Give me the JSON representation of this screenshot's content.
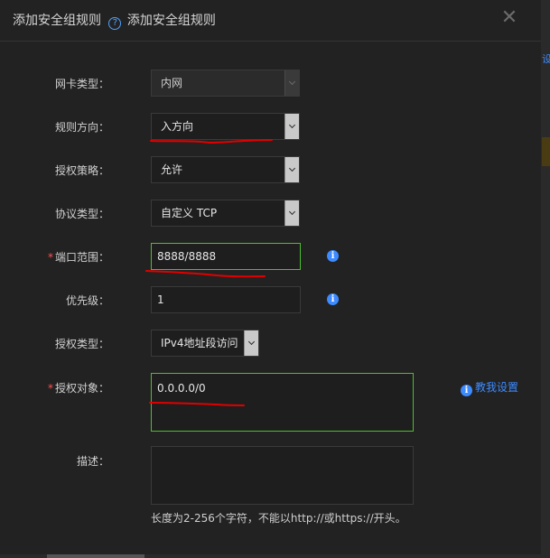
{
  "dialog": {
    "title": "添加安全组规则",
    "help_label": "添加安全组规则",
    "close_glyph": "✕"
  },
  "form": {
    "nic_type": {
      "label": "网卡类型：",
      "value": "内网"
    },
    "direction": {
      "label": "规则方向：",
      "value": "入方向"
    },
    "policy": {
      "label": "授权策略：",
      "value": "允许"
    },
    "protocol": {
      "label": "协议类型：",
      "value": "自定义 TCP"
    },
    "port_range": {
      "required_mark": "*",
      "label": "端口范围：",
      "value": "8888/8888"
    },
    "priority": {
      "label": "优先级：",
      "value": "1"
    },
    "auth_type": {
      "label": "授权类型：",
      "value": "IPv4地址段访问"
    },
    "auth_target": {
      "required_mark": "*",
      "label": "授权对象：",
      "value": "0.0.0.0/0"
    },
    "description": {
      "label": "描述：",
      "value": "",
      "hint": "长度为2-256个字符，不能以http://或https://开头。"
    }
  },
  "teach": {
    "label": "教我设置"
  },
  "edge": {
    "text": "设"
  },
  "icons": {
    "info": "info-icon",
    "help": "question-icon",
    "close": "close-icon",
    "dropdown": "chevron-down-icon"
  },
  "colors": {
    "accent": "#3d8bff",
    "valid_border": "#4fbf2c",
    "required": "#ff5050",
    "annotation": "#e00000"
  }
}
